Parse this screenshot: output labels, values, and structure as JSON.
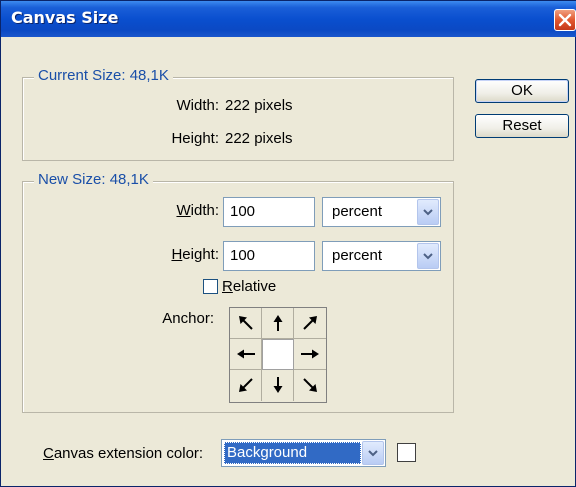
{
  "window": {
    "title": "Canvas Size"
  },
  "current_size": {
    "legend": "Current Size: 48,1K",
    "width_label": "Width:",
    "width_value": "222 pixels",
    "height_label": "Height:",
    "height_value": "222 pixels"
  },
  "new_size": {
    "legend": "New Size: 48,1K",
    "width_label_mnemonic": "W",
    "width_label_rest": "idth:",
    "width_value": "100",
    "width_unit": "percent",
    "height_label_mnemonic": "H",
    "height_label_rest": "eight:",
    "height_value": "100",
    "height_unit": "percent",
    "relative_mnemonic": "R",
    "relative_rest": "elative",
    "relative_checked": false,
    "anchor_label": "Anchor:",
    "anchor_icons": [
      "arrow-up-left-icon",
      "arrow-up-icon",
      "arrow-up-right-icon",
      "arrow-left-icon",
      "anchor-center",
      "arrow-right-icon",
      "arrow-down-left-icon",
      "arrow-down-icon",
      "arrow-down-right-icon"
    ]
  },
  "buttons": {
    "ok": "OK",
    "reset": "Reset"
  },
  "extension": {
    "label_mnemonic": "C",
    "label_rest": "anvas extension color:",
    "selected": "Background",
    "swatch_color": "#ffffff"
  },
  "colors": {
    "titlebar": "#0a4fcf",
    "legend_text": "#1a4fa8",
    "selection": "#316ac5",
    "dialog_bg": "#ece9d8"
  }
}
